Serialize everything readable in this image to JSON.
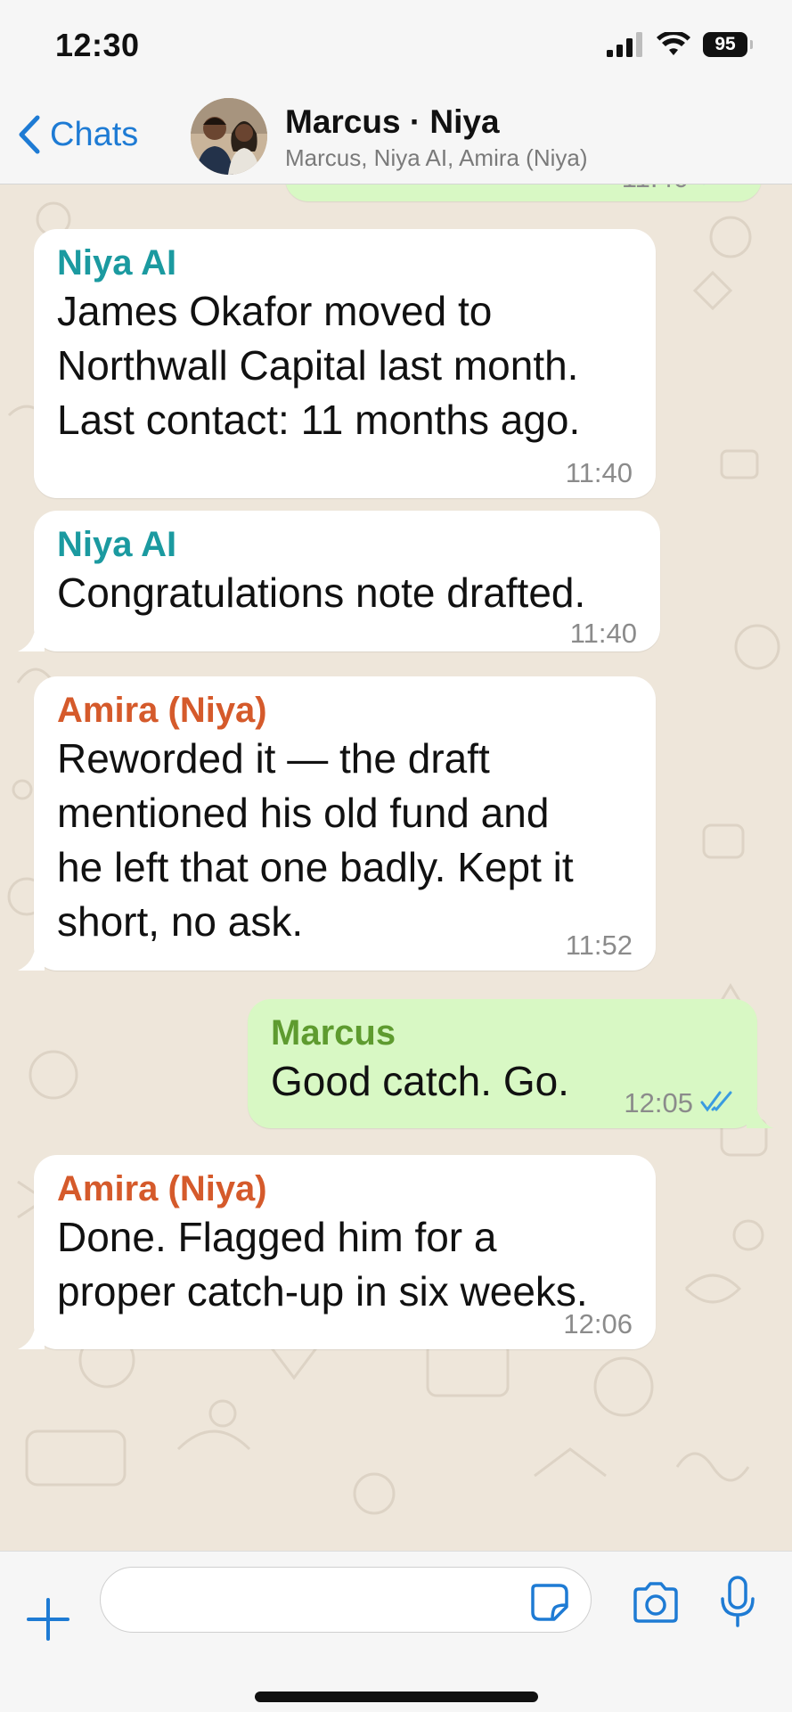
{
  "status_bar": {
    "time": "12:30",
    "battery": "95"
  },
  "header": {
    "back_label": "Chats",
    "title": "Marcus · Niya",
    "subtitle": "Marcus, Niya AI, Amira (Niya)"
  },
  "colors": {
    "accent": "#1e7bd4",
    "niya_ai": "#1b9aa0",
    "amira": "#d55a2b",
    "marcus": "#5e9b2f",
    "outgoing_bubble": "#d8f8c4",
    "read_ticks": "#3a9be0"
  },
  "partial_message": {
    "time": "11:40"
  },
  "messages": [
    {
      "sender": "Niya AI",
      "lines": [
        "James Okafor moved to",
        "Northwall Capital last month.",
        "Last contact: 11 months ago."
      ],
      "time": "11:40"
    },
    {
      "sender": "Niya AI",
      "lines": [
        "Congratulations note drafted."
      ],
      "time": "11:40"
    },
    {
      "sender": "Amira (Niya)",
      "lines": [
        "Reworded it — the draft",
        "mentioned his old fund and",
        "he left that one badly. Kept it",
        "short, no ask."
      ],
      "time": "11:52"
    },
    {
      "sender": "Marcus",
      "lines": [
        "Good catch. Go."
      ],
      "time": "12:05"
    },
    {
      "sender": "Amira (Niya)",
      "lines": [
        "Done. Flagged him for a",
        "proper catch-up in six weeks."
      ],
      "time": "12:06"
    }
  ],
  "input": {
    "placeholder": ""
  },
  "icons": {
    "back": "chevron-left-icon",
    "plus": "plus-icon",
    "sticker": "sticker-icon",
    "camera": "camera-icon",
    "mic": "microphone-icon",
    "signal": "signal-icon",
    "wifi": "wifi-icon",
    "read": "double-check-icon"
  }
}
